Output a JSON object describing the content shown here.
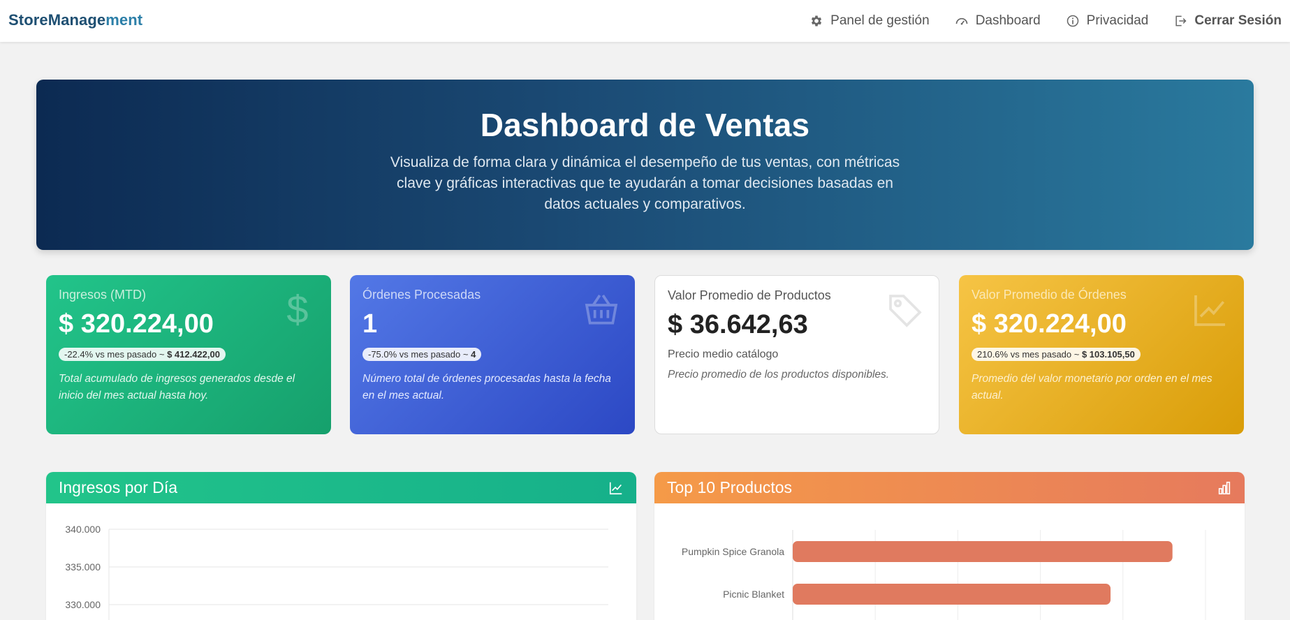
{
  "navbar": {
    "brand_part1": "StoreManage",
    "brand_part2": "ment",
    "links": [
      {
        "label": "Panel de gestión",
        "icon": "gear-icon"
      },
      {
        "label": "Dashboard",
        "icon": "speedometer-icon"
      },
      {
        "label": "Privacidad",
        "icon": "info-icon"
      },
      {
        "label": "Cerrar Sesión",
        "icon": "logout-icon"
      }
    ]
  },
  "hero": {
    "title": "Dashboard de Ventas",
    "subtitle": "Visualiza de forma clara y dinámica el desempeño de tus ventas, con métricas clave y gráficas interactivas que te ayudarán a tomar decisiones basadas en datos actuales y comparativos."
  },
  "cards": [
    {
      "label": "Ingresos (MTD)",
      "value": "$ 320.224,00",
      "pill_change": "-22.4% vs mes pasado ~ ",
      "pill_ref": "$ 412.422,00",
      "description": "Total acumulado de ingresos generados desde el inicio del mes actual hasta hoy.",
      "icon": "dollar-icon"
    },
    {
      "label": "Órdenes Procesadas",
      "value": "1",
      "pill_change": "-75.0% vs mes pasado ~ ",
      "pill_ref": "4",
      "description": "Número total de órdenes procesadas hasta la fecha en el mes actual.",
      "icon": "basket-icon"
    },
    {
      "label": "Valor Promedio de Productos",
      "value": "$ 36.642,63",
      "sub": "Precio medio catálogo",
      "description": "Precio promedio de los productos disponibles.",
      "icon": "tag-icon"
    },
    {
      "label": "Valor Promedio de Órdenes",
      "value": "$ 320.224,00",
      "pill_change": "210.6% vs mes pasado ~ ",
      "pill_ref": "$ 103.105,50",
      "description": "Promedio del valor monetario por orden en el mes actual.",
      "icon": "line-chart-icon"
    }
  ],
  "panels": {
    "daily_title": "Ingresos por Día",
    "top_title": "Top 10 Productos"
  },
  "colors": {
    "green": "#22c48a",
    "blue": "#3a5bd6",
    "gold": "#f2b823",
    "bar": "#e07a5f"
  },
  "chart_data": [
    {
      "type": "line",
      "title": "Ingresos por Día",
      "ytick_labels": [
        "340.000",
        "335.000",
        "330.000"
      ],
      "ylim": [
        330000,
        340000
      ],
      "grid": true
    },
    {
      "type": "bar",
      "orientation": "horizontal",
      "title": "Top 10 Productos",
      "categories": [
        "Pumpkin Spice Granola",
        "Picnic Blanket"
      ],
      "values": [
        4.6,
        3.85
      ],
      "xlim": [
        0,
        5
      ],
      "grid": true
    }
  ]
}
